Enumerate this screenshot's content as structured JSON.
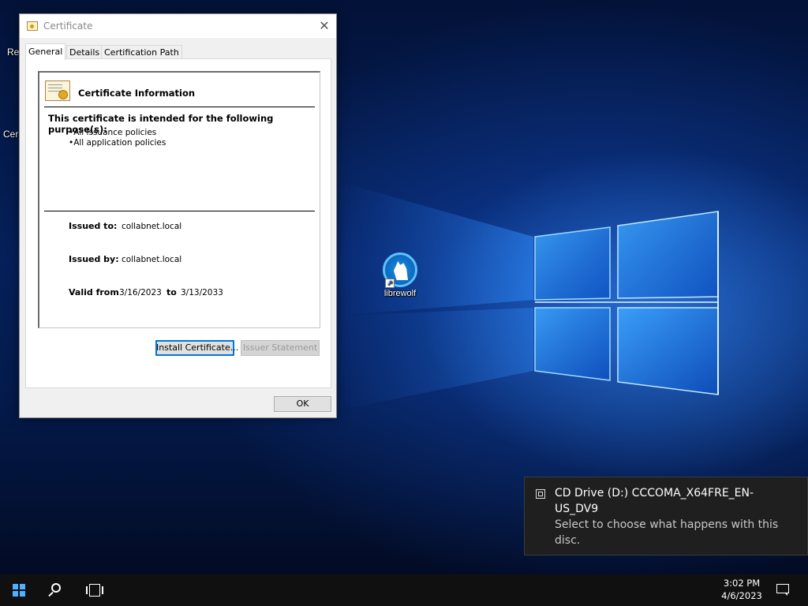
{
  "desktop": {
    "icons": [
      {
        "label": "librewolf",
        "icon": "librewolf-icon"
      }
    ],
    "partial_labels": [
      "Re",
      "Cer"
    ]
  },
  "dialog": {
    "title": "Certificate",
    "close_glyph": "✕",
    "tabs": [
      {
        "label": "General",
        "active": true
      },
      {
        "label": "Details",
        "active": false
      },
      {
        "label": "Certification Path",
        "active": false
      }
    ],
    "info_header": "Certificate Information",
    "purpose_title": "This certificate is intended for the following purpose(s):",
    "purposes": [
      "All issuance policies",
      "All application policies"
    ],
    "issued_to_label": "Issued to:",
    "issued_to": "collabnet.local",
    "issued_by_label": "Issued by:",
    "issued_by": "collabnet.local",
    "valid_from_label": "Valid from",
    "valid_from": "3/16/2023",
    "to_label": "to",
    "valid_to": "3/13/2033",
    "install_button": "Install Certificate...",
    "issuer_statement_button": "Issuer Statement",
    "ok_button": "OK"
  },
  "toast": {
    "title": "CD Drive (D:) CCCOMA_X64FRE_EN-US_DV9",
    "body": "Select to choose what happens with this disc."
  },
  "taskbar": {
    "time": "3:02 PM",
    "date": "4/6/2023"
  },
  "colors": {
    "accent": "#0078d7",
    "taskbar": "#101010",
    "toast_bg": "#1f1f1f",
    "wallpaper_glow": "#3c96ff"
  }
}
